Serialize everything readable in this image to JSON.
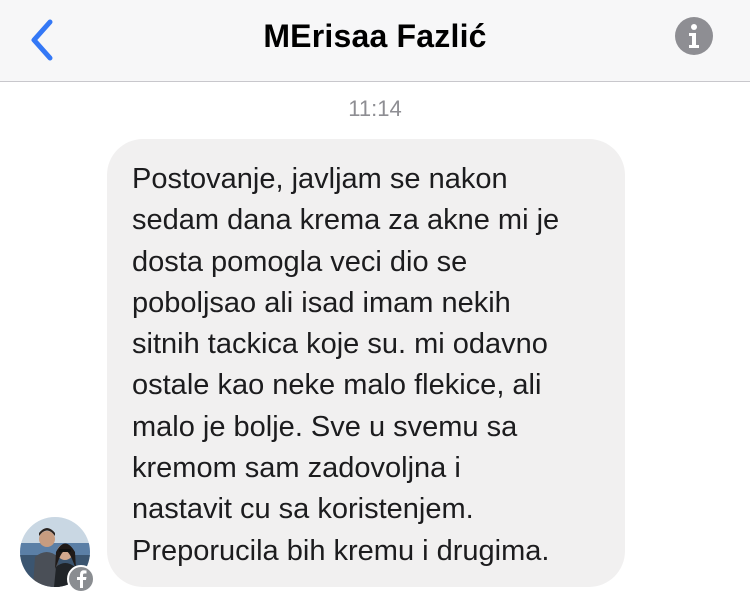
{
  "header": {
    "title": "MErisaa Fazlić",
    "back_icon": "chevron-left-icon",
    "info_icon": "info-icon",
    "accent_color": "#3478f6"
  },
  "conversation": {
    "timestamp": "11:14",
    "message": {
      "lines": [
        "Postovanje, javljam se nakon",
        "sedam dana krema za akne mi je",
        "dosta pomogla veci dio se",
        "poboljsao ali isad imam nekih",
        "sitnih tackica koje su. mi odavno",
        "ostale kao neke malo flekice, ali",
        "malo je bolje. Sve u svemu sa",
        "kremom sam zadovoljna i",
        "nastavit cu sa koristenjem.",
        "Preporucila bih kremu i drugima."
      ],
      "bubble_color": "#f1f0f0"
    },
    "sender": {
      "avatar": "contact-avatar-photo",
      "badge_icon": "facebook-icon"
    }
  }
}
